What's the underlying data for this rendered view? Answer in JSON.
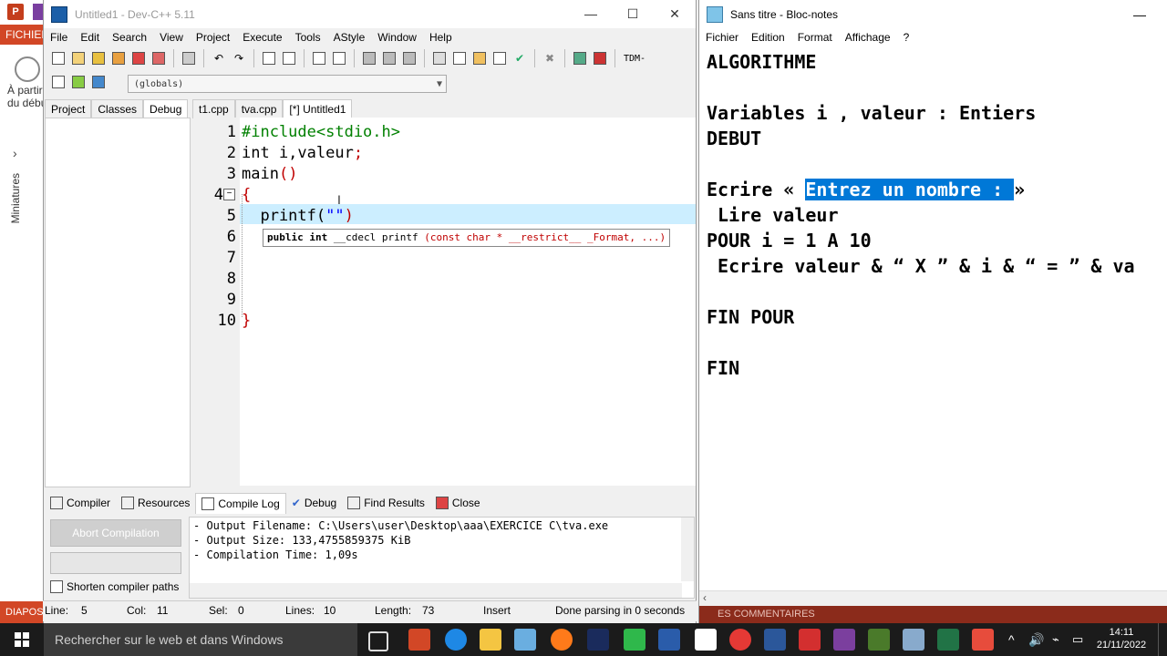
{
  "background_app": {
    "fichier_label": "FICHIER",
    "apartir_label": "À partir",
    "dudeb_label": "du débu",
    "miniatures_label": "Miniatures",
    "status_label": "DIAPOS",
    "ppt_glyph": "P"
  },
  "devcpp": {
    "title": "Untitled1 - Dev-C++ 5.11",
    "menu": [
      "File",
      "Edit",
      "Search",
      "View",
      "Project",
      "Execute",
      "Tools",
      "AStyle",
      "Window",
      "Help"
    ],
    "tdm_label": "TDM-",
    "globals": "(globals)",
    "left_tabs": [
      "Project",
      "Classes",
      "Debug"
    ],
    "file_tabs": [
      "t1.cpp",
      "tva.cpp",
      "[*] Untitled1"
    ],
    "line_numbers": [
      "1",
      "2",
      "3",
      "4",
      "5",
      "6",
      "7",
      "8",
      "9",
      "10"
    ],
    "code": {
      "l1": "#include<stdio.h>",
      "l2a": "int i,valeur",
      "l2b": ";",
      "l3a": "main",
      "l3b": "()",
      "l4": "{",
      "l5a": "  printf(",
      "l5b": "\"\"",
      "l5c": ")",
      "l10": "}"
    },
    "tooltip": {
      "a": "public int",
      "b": " __cdecl printf ",
      "c": "(const char * __restrict__ _Format, ...)"
    },
    "bottom_tabs": [
      "Compiler",
      "Resources",
      "Compile Log",
      "Debug",
      "Find Results",
      "Close"
    ],
    "abort_label": "Abort Compilation",
    "shorten_label": "Shorten compiler paths",
    "log": [
      "- Output Filename: C:\\Users\\user\\Desktop\\aaa\\EXERCICE C\\tva.exe",
      "- Output Size: 133,4755859375 KiB",
      "- Compilation Time: 1,09s"
    ],
    "status": {
      "line": "Line:",
      "line_val": "5",
      "col": "Col:",
      "col_val": "11",
      "sel": "Sel:",
      "sel_val": "0",
      "lines": "Lines:",
      "lines_val": "10",
      "length": "Length:",
      "length_val": "73",
      "mode": "Insert",
      "parse": "Done parsing in 0 seconds"
    }
  },
  "notepad": {
    "title": "Sans titre - Bloc-notes",
    "menu": [
      "Fichier",
      "Edition",
      "Format",
      "Affichage",
      "?"
    ],
    "lines": {
      "l1": "ALGORITHME",
      "l3": "Variables i , valeur : Entiers",
      "l4": "DEBUT",
      "l6a": "Ecrire « ",
      "l6sel": "Entrez un nombre : ",
      "l6b": "»",
      "l7": " Lire valeur",
      "l8": "POUR i = 1 A 10",
      "l9": " Ecrire valeur & “ X ” & i & “ = ” & va",
      "l11": "FIN POUR",
      "l13": "FIN"
    },
    "status_text": "ES    COMMENTAIRES"
  },
  "taskbar": {
    "search_placeholder": "Rechercher sur le web et dans Windows",
    "time": "14:11",
    "date": "21/11/2022"
  }
}
